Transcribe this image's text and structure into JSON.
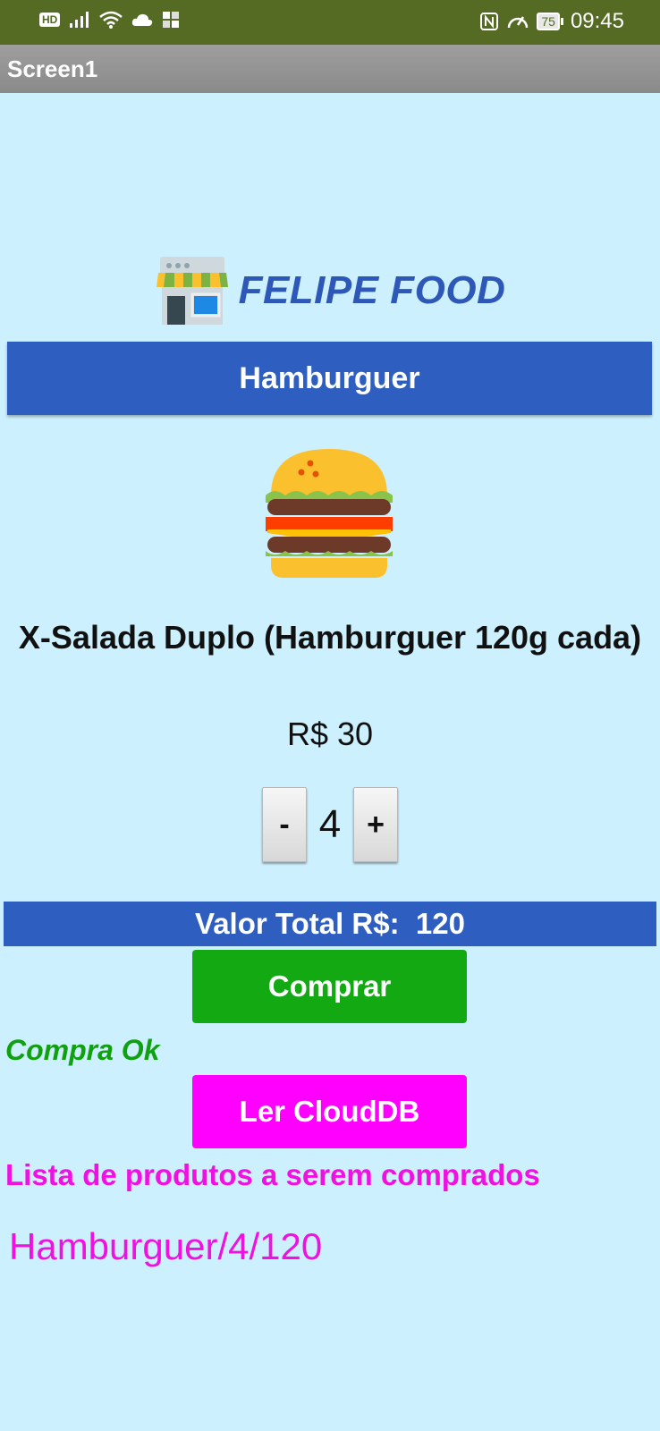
{
  "status_bar": {
    "left_badge": "HD",
    "battery": "75",
    "time": "09:45"
  },
  "app": {
    "title": "Screen1"
  },
  "store": {
    "name": "FELIPE FOOD"
  },
  "category": {
    "label": "Hamburguer"
  },
  "product": {
    "name": "X-Salada Duplo (Hamburguer 120g cada)",
    "price": "R$ 30"
  },
  "quantity": {
    "minus_label": "-",
    "value": "4",
    "plus_label": "+"
  },
  "total": {
    "label": "Valor Total R$:  120"
  },
  "buttons": {
    "buy_label": "Comprar",
    "read_label": "Ler CloudDB"
  },
  "purchase_status": "Compra Ok",
  "shopping_list": {
    "heading": "Lista de produtos a serem comprados",
    "items": [
      "Hamburguer/4/120"
    ]
  },
  "colors": {
    "status_bar": "#556a23",
    "background": "#cdf0fe",
    "brand_blue": "#2e5ec0",
    "buy_green": "#12a912",
    "read_magenta": "#ff00ff",
    "list_text": "#f010e0"
  },
  "icons": [
    "hd-icon",
    "signal-icon",
    "wifi-icon",
    "cloud-icon",
    "notification-icon",
    "nfc-icon",
    "speed-icon",
    "battery-icon",
    "store-icon",
    "burger-icon"
  ]
}
